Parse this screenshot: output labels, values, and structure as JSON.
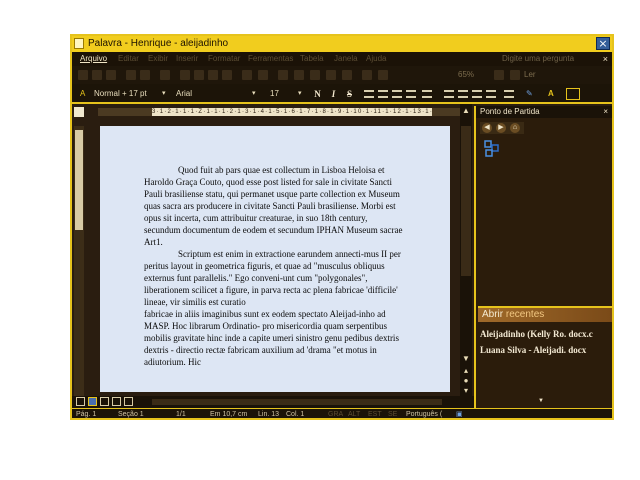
{
  "window": {
    "title": "Palavra - Henrique - aleijadinho",
    "close_glyph": "×"
  },
  "menu": {
    "items": [
      "Arquivo",
      "Editar",
      "Exibir",
      "Inserir",
      "Formatar",
      "Ferramentas",
      "Tabela",
      "Janela",
      "Ajuda"
    ],
    "help_placeholder": "Digite uma pergunta",
    "close_glyph": "×"
  },
  "toolbar1": {
    "zoom": "65%",
    "read_label": "Ler"
  },
  "toolbar2": {
    "style": "Normal + 17 pt",
    "font": "Arial",
    "size": "17",
    "bold": "N",
    "italic": "I",
    "strike": "S"
  },
  "ruler": {
    "ticks": "3·1·2·1·1·1·Z·1·1·1·2·1·3·1·4·1·5·1·6·1·7·1·8·1·9·1·10·1·11·1·12·1·13·1·14·1·15·"
  },
  "document": {
    "paragraphs": [
      {
        "indent": true,
        "text": "Quod fuit ab pars quae est collectum in Lisboa Heloisa et Haroldo Graça Couto, quod esse post listed for sale in civitate Sancti Pauli brasiliense statu, qui permanet usque parte collection ex Museum quas sacra ars producere in civitate Sancti Pauli brasiliense. Morbi est opus sit incerta, cum attribuitur creaturae, in suo 18th century, secundum documentum de eodem et secundum IPHAN Museum sacrae Art1."
      },
      {
        "indent": true,
        "text": "Scriptum est enim in extractione earundem annecti-mus II per peritus layout in geometrica figuris, et quae ad \"musculus obliquus externus funt parallelis.\" Ego conveni-unt cum \"polygonales\", liberationem scilicet a figure, in parva recta ac plena fabricae 'difficile' lineae, vir similis est curatio"
      },
      {
        "indent": false,
        "text": "fabricae in aliis imaginibus sunt ex eodem spectato Aleijad-inho ad MASP. Hoc librarum Ordinatio- pro misericordia quam serpentibus mobilis gravitate hinc inde a capite umeri sinistro genu pedibus dextris dextris - directio rectæ fabricam auxilium ad 'drama \"et motus in adiutorium. Hic"
      }
    ]
  },
  "status": {
    "page": "Pág. 1",
    "section": "Seção 1",
    "pages": "1/1",
    "position": "Em  10,7 cm",
    "line": "Lin. 13",
    "column": "Col. 1",
    "modes": [
      "GRA",
      "ALT",
      "EST",
      "SE"
    ],
    "language": "Português ("
  },
  "taskpane": {
    "title": "Ponto de Partida",
    "close_glyph": "×",
    "recent_header_first": "Abrir ",
    "recent_header_rest": "recentes",
    "recent_files": [
      "Aleijadinho (Kelly Ro. docx.c",
      "Luana Silva - Aleijadi. docx"
    ]
  },
  "colors": {
    "accent": "#e6c31c",
    "window_bg": "#2a1d10",
    "page_bg": "#dde6f4",
    "recent_header": "#a06a2a"
  }
}
